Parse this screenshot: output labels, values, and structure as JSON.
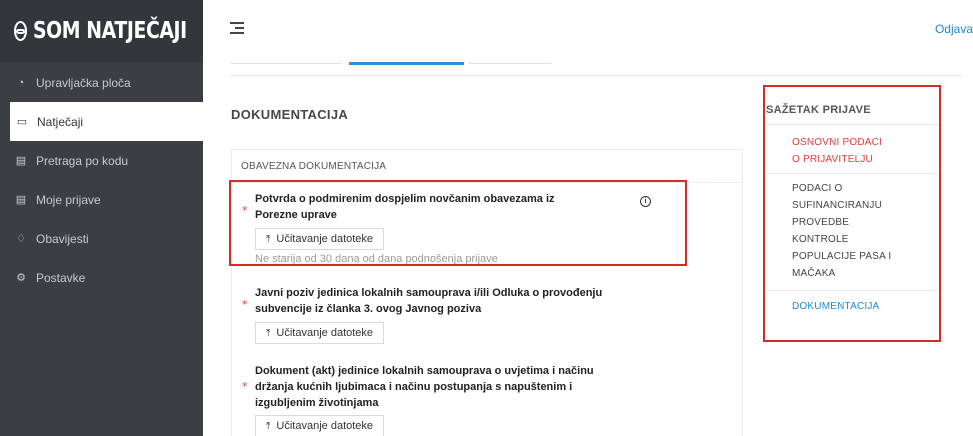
{
  "brand": {
    "logo_text": "SOM NATJEČAJI"
  },
  "sidebar": {
    "items": [
      {
        "label": "Upravljačka ploča",
        "icon": "dashboard-icon",
        "active": false
      },
      {
        "label": "Natječaji",
        "icon": "folder-icon",
        "active": true
      },
      {
        "label": "Pretraga po kodu",
        "icon": "document-search-icon",
        "active": false
      },
      {
        "label": "Moje prijave",
        "icon": "document-icon",
        "active": false
      },
      {
        "label": "Obavijesti",
        "icon": "bell-icon",
        "active": false
      },
      {
        "label": "Postavke",
        "icon": "gear-icon",
        "active": false
      }
    ]
  },
  "header": {
    "logout_label": "Odjava"
  },
  "main": {
    "section_title": "DOKUMENTACIJA",
    "doc_group_title": "OBAVEZNA DOKUMENTACIJA",
    "documents": [
      {
        "required": "*",
        "label_line1": "Potvrda o podmirenim dospjelim novčanim obavezama iz",
        "label_line2": "Porezne uprave",
        "upload_label": "Učitavanje datoteke",
        "hint": "Ne starija od 30 dana od dana podnošenja prijave"
      },
      {
        "required": "*",
        "label_line1": "Javni poziv jedinica lokalnih samouprava i/ili Odluka o provođenju",
        "label_line2": "subvencije iz članka 3. ovog Javnog poziva",
        "upload_label": "Učitavanje datoteke"
      },
      {
        "required": "*",
        "label_line1": "Dokument (akt) jedinice lokalnih samouprava o uvjetima i načinu",
        "label_line2": "držanja kućnih ljubimaca i načinu postupanja s napuštenim i",
        "label_line3": "izgubljenim životinjama",
        "upload_label": "Učitavanje datoteke"
      }
    ]
  },
  "summary": {
    "title": "SAŽETAK PRIJAVE",
    "items": [
      {
        "line1": "OSNOVNI PODACI",
        "line2": "O PRIJAVITELJU",
        "color": "#e23b3b"
      },
      {
        "line1": "PODACI O",
        "line2": "SUFINANCIRANJU",
        "line3": "PROVEDBE",
        "line4": "KONTROLE",
        "line5": "POPULACIJE PASA I",
        "line6": "MAČAKA",
        "color": "#444444"
      },
      {
        "line1": "DOKUMENTACIJA",
        "color": "#1d8ad6"
      }
    ]
  },
  "colors": {
    "sidebar_bg": "#3b3f44",
    "accent": "#1d8ad6",
    "highlight_red": "#d92a2a"
  }
}
